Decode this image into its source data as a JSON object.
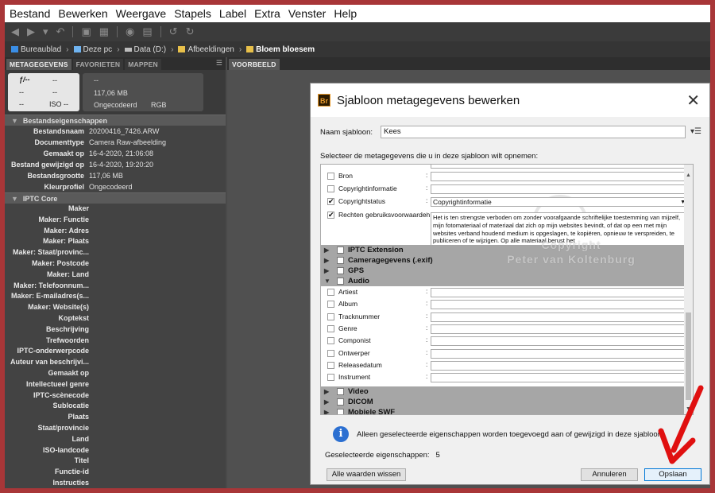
{
  "menubar": {
    "items": [
      "Bestand",
      "Bewerken",
      "Weergave",
      "Stapels",
      "Label",
      "Extra",
      "Venster",
      "Help"
    ]
  },
  "toolbar": {
    "icons": [
      "back-icon",
      "forward-icon",
      "recent-icon",
      "boomerang-icon",
      "camera-download-icon",
      "refine-icon",
      "open-with-icon",
      "rotate-left-icon",
      "rotate-right-icon"
    ]
  },
  "pathbar": {
    "crumbs": [
      "Bureaublad",
      "Deze pc",
      "Data (D:)",
      "Afbeeldingen",
      "Bloem bloesem"
    ]
  },
  "leftpanel": {
    "tabs": [
      "METAGEGEVENS",
      "FAVORIETEN",
      "MAPPEN"
    ],
    "camera": {
      "aperture": "ƒ/--",
      "shutter": "--",
      "row2a": "--",
      "row2b": "--",
      "row3a": "--",
      "iso": "ISO --"
    },
    "fileinfo": {
      "dims": "--",
      "size": "117,06 MB",
      "compression": "Ongecodeerd",
      "colormode": "RGB"
    },
    "file_properties_title": "Bestandseigenschappen",
    "file_properties": [
      {
        "label": "Bestandsnaam",
        "value": "20200416_7426.ARW"
      },
      {
        "label": "Documenttype",
        "value": "Camera Raw-afbeelding"
      },
      {
        "label": "Gemaakt op",
        "value": "16-4-2020, 21:06:08"
      },
      {
        "label": "Bestand gewijzigd op",
        "value": "16-4-2020, 19:20:20"
      },
      {
        "label": "Bestandsgrootte",
        "value": "117,06 MB"
      },
      {
        "label": "Kleurprofiel",
        "value": "Ongecodeerd"
      }
    ],
    "iptc_title": "IPTC Core",
    "iptc_fields": [
      "Maker",
      "Maker: Functie",
      "Maker: Adres",
      "Maker: Plaats",
      "Maker: Staat/provinc...",
      "Maker: Postcode",
      "Maker: Land",
      "Maker: Telefoonnum...",
      "Maker: E-mailadres(s...",
      "Maker: Website(s)",
      "Koptekst",
      "Beschrijving",
      "Trefwoorden",
      "IPTC-onderwerpcode",
      "Auteur van beschrijvi...",
      "Gemaakt op",
      "Intellectueel genre",
      "IPTC-scènecode",
      "Sublocatie",
      "Plaats",
      "Staat/provincie",
      "Land",
      "ISO-landcode",
      "Titel",
      "Functie-id",
      "Instructies"
    ]
  },
  "preview": {
    "tab": "VOORBEELD"
  },
  "dialog": {
    "title": "Sjabloon metagegevens bewerken",
    "logo": "Br",
    "name_label": "Naam sjabloon:",
    "name_value": "Kees",
    "select_label": "Selecteer de metagegevens die u in deze sjabloon wilt opnemen:",
    "top_rows": [
      {
        "label": "Bron",
        "checked": false
      },
      {
        "label": "Copyrightinformatie",
        "checked": false
      },
      {
        "label": "Copyrightstatus",
        "checked": true,
        "dropdown": "Copyrightinformatie"
      },
      {
        "label": "Rechten gebruiksvoorwaarden",
        "checked": true
      }
    ],
    "rights_text": "Het is ten strengste verboden om zonder voorafgaande schriftelijke toestemming van mijzelf, mijn fotomateriaal of materiaal dat zich op mijn websites bevindt, of dat op een met mijn websites verband houdend medium is opgeslagen, te kopiëren, opnieuw te verspreiden, te publiceren of te wijzigen. Op alle materiaal berust het",
    "groups_before": [
      "IPTC Extension",
      "Cameragegevens (.exif)",
      "GPS"
    ],
    "audio_group": "Audio",
    "audio_rows": [
      "Artiest",
      "Album",
      "Tracknummer",
      "Genre",
      "Componist",
      "Ontwerper",
      "Releasedatum",
      "Instrument"
    ],
    "groups_after": [
      "Video",
      "DICOM",
      "Mobiele SWF"
    ],
    "watermark_line1": "Copyright",
    "watermark_line2": "Peter van Koltenburg",
    "info_text": "Alleen geselecteerde eigenschappen worden toegevoegd aan of gewijzigd in deze sjabloon.",
    "selected_label": "Geselecteerde eigenschappen:",
    "selected_count": "5",
    "btn_clear": "Alle waarden wissen",
    "btn_cancel": "Annuleren",
    "btn_save": "Opslaan"
  },
  "colors": {
    "frame": "#a83638",
    "arrow": "#e01010",
    "save_border": "#0078d7"
  }
}
